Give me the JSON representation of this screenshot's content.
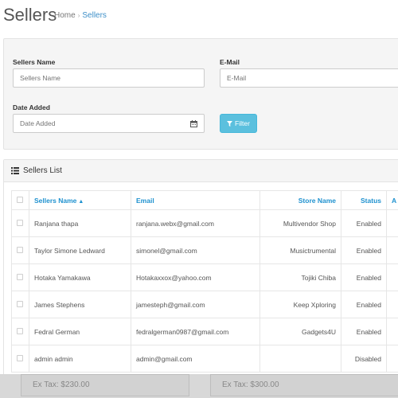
{
  "header": {
    "title": "Sellers",
    "breadcrumb": {
      "home": "Home",
      "separator": "›",
      "current": "Sellers"
    }
  },
  "filter": {
    "sellers_name_label": "Sellers Name",
    "sellers_name_placeholder": "Sellers Name",
    "email_label": "E-Mail",
    "email_placeholder": "E-Mail",
    "date_added_label": "Date Added",
    "date_added_placeholder": "Date Added",
    "filter_button": "Filter"
  },
  "list": {
    "title": "Sellers List",
    "columns": {
      "name": "Sellers Name",
      "email": "Email",
      "store": "Store Name",
      "status": "Status",
      "extra": "A"
    },
    "rows": [
      {
        "name": "Ranjana thapa",
        "email": "ranjana.webx@gmail.com",
        "store": "Multivendor Shop",
        "status": "Enabled"
      },
      {
        "name": "Taylor Simone Ledward",
        "email": "simonel@gmail.com",
        "store": "Musictrumental",
        "status": "Enabled"
      },
      {
        "name": "Hotaka Yamakawa",
        "email": "Hotakaxxox@yahoo.com",
        "store": "Tojiki Chiba",
        "status": "Enabled"
      },
      {
        "name": "James Stephens",
        "email": "jamesteph@gmail.com",
        "store": "Keep Xploring",
        "status": "Enabled"
      },
      {
        "name": "Fedral German",
        "email": "fedralgerman0987@gmail.com",
        "store": "Gadgets4U",
        "status": "Enabled"
      },
      {
        "name": "admin admin",
        "email": "admin@gmail.com",
        "store": "",
        "status": "Disabled"
      }
    ]
  },
  "footer": {
    "tax_left": "Ex Tax: $230.00",
    "tax_right": "Ex Tax: $300.00"
  },
  "colors": {
    "accent": "#1e91cf",
    "filter_button": "#5bc0de"
  }
}
